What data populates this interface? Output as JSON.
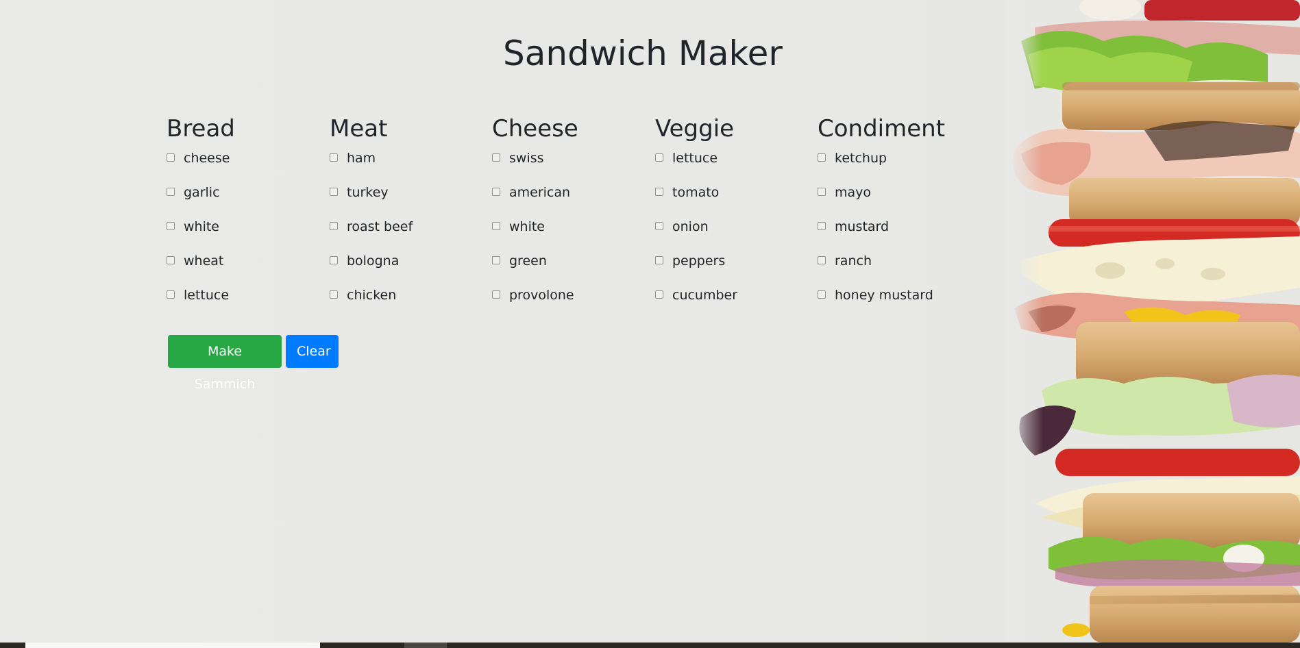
{
  "page": {
    "title": "Sandwich Maker"
  },
  "categories": [
    {
      "heading": "Bread",
      "options": [
        "cheese",
        "garlic",
        "white",
        "wheat",
        "lettuce"
      ]
    },
    {
      "heading": "Meat",
      "options": [
        "ham",
        "turkey",
        "roast beef",
        "bologna",
        "chicken"
      ]
    },
    {
      "heading": "Cheese",
      "options": [
        "swiss",
        "american",
        "white",
        "green",
        "provolone"
      ]
    },
    {
      "heading": "Veggie",
      "options": [
        "lettuce",
        "tomato",
        "onion",
        "peppers",
        "cucumber"
      ]
    },
    {
      "heading": "Condiment",
      "options": [
        "ketchup",
        "mayo",
        "mustard",
        "ranch",
        "honey mustard"
      ]
    }
  ],
  "actions": {
    "make_label": "Make Sammich",
    "clear_label": "Clear"
  },
  "colors": {
    "make_button": "#28a745",
    "clear_button": "#007bff",
    "background": "#e8e8e6",
    "text": "#212529"
  }
}
